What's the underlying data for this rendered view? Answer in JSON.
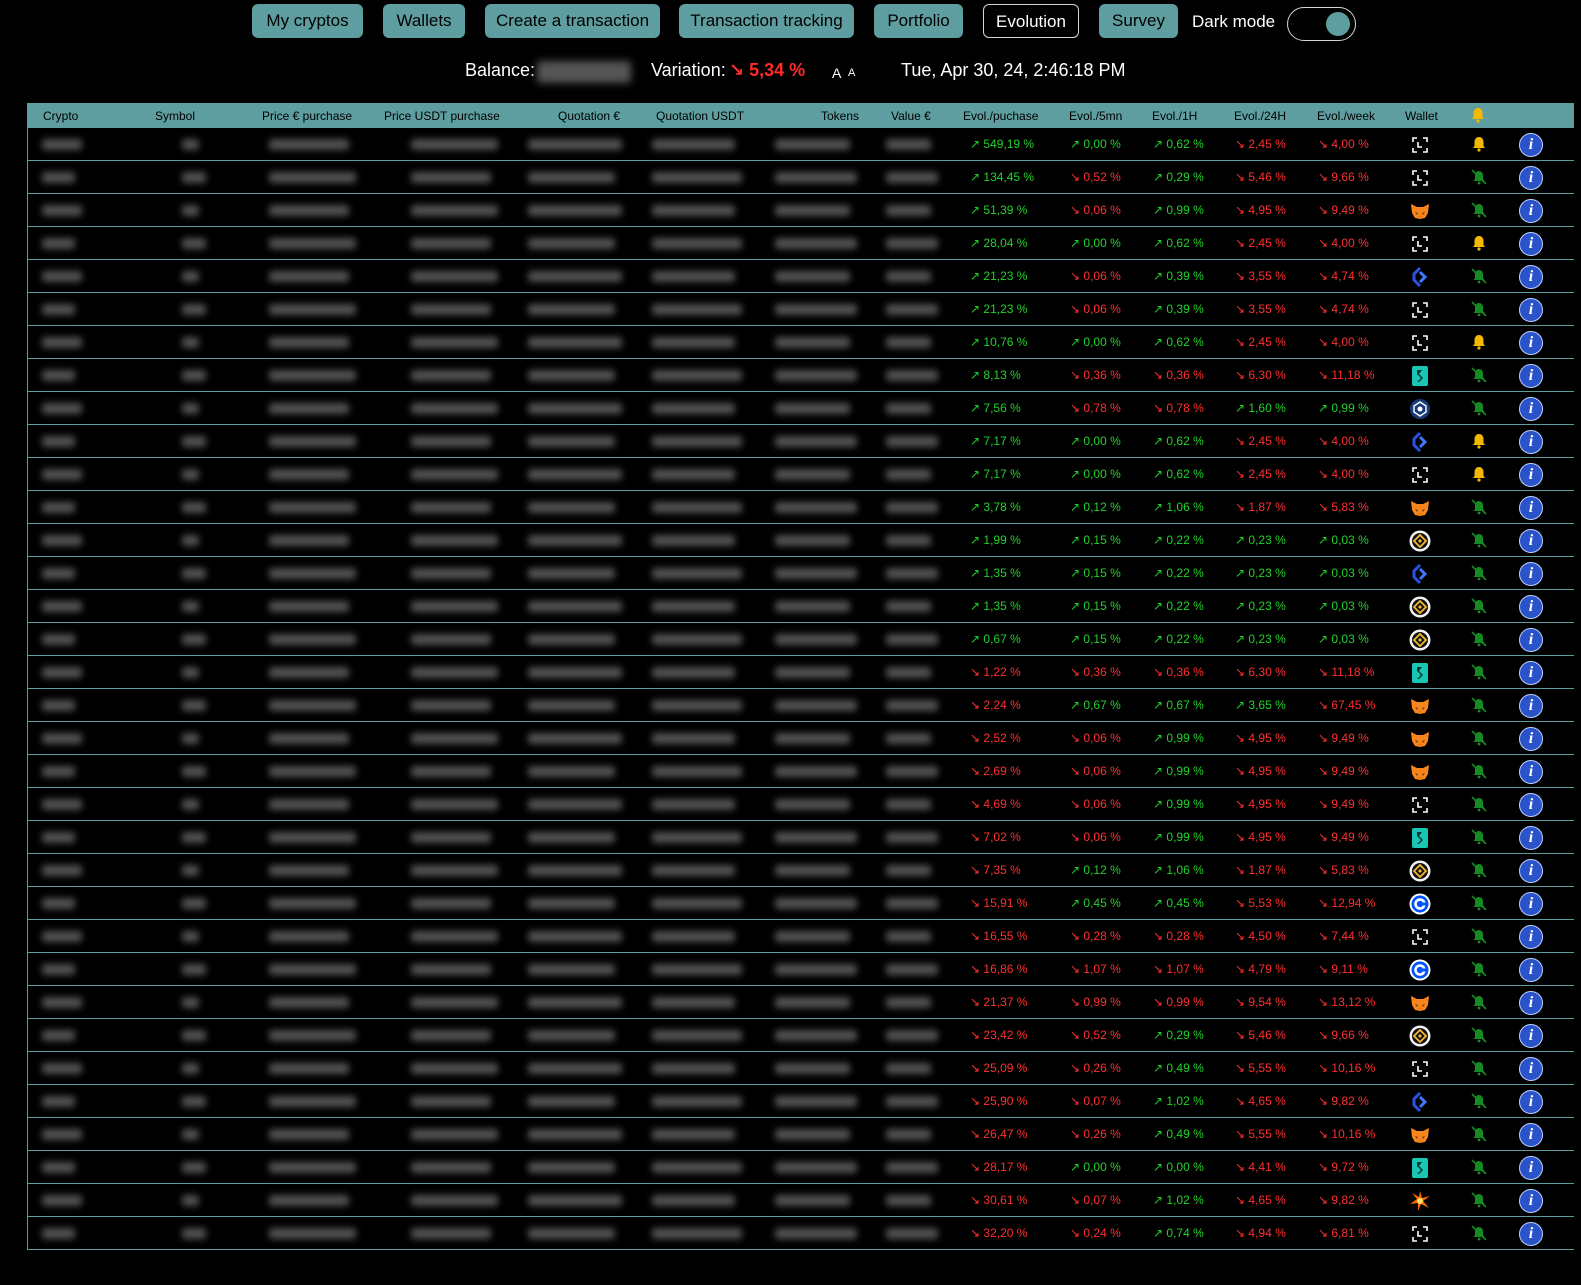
{
  "nav": {
    "buttons": [
      "My cryptos",
      "Wallets",
      "Create a transaction",
      "Transaction tracking",
      "Portfolio",
      "Evolution",
      "Survey"
    ],
    "active": "Evolution",
    "dark_mode_label": "Dark mode",
    "dark_mode_on": true
  },
  "status": {
    "balance_label": "Balance:",
    "variation_label": "Variation:",
    "variation_value": "↘ 5,34 %",
    "font_large": "A",
    "font_small": "A",
    "datetime": "Tue, Apr 30, 24, 2:46:18 PM"
  },
  "colors": {
    "accent": "#5f9ea0",
    "up": "#22d22a",
    "down": "#ff3030",
    "bell_on": "#f5b800",
    "info": "#2a52c9"
  },
  "table": {
    "headers": [
      "Crypto",
      "Symbol",
      "Price € purchase",
      "Price USDT purchase",
      "Quotation €",
      "Quotation USDT",
      "Tokens",
      "Value €",
      "Evol./puchase",
      "Evol./5mn",
      "Evol./1H",
      "Evol./24H",
      "Evol./week",
      "Wallet"
    ],
    "header_bell_icon": "bell-icon",
    "rows": [
      {
        "e": [
          "↗ 549,19 %",
          "↗ 0,00 %",
          "↗ 0,62 %",
          "↘ 2,45 %",
          "↘ 4,00 %"
        ],
        "wallet": "ledger-icon",
        "bell": "bell-on-icon"
      },
      {
        "e": [
          "↗ 134,45 %",
          "↘ 0,52 %",
          "↗ 0,29 %",
          "↘ 5,46 %",
          "↘ 9,66 %"
        ],
        "wallet": "ledger-icon",
        "bell": "bell-off-icon"
      },
      {
        "e": [
          "↗ 51,39 %",
          "↘ 0,06 %",
          "↗ 0,99 %",
          "↘ 4,95 %",
          "↘ 9,49 %"
        ],
        "wallet": "metamask-icon",
        "bell": "bell-off-icon"
      },
      {
        "e": [
          "↗ 28,04 %",
          "↗ 0,00 %",
          "↗ 0,62 %",
          "↘ 2,45 %",
          "↘ 4,00 %"
        ],
        "wallet": "ledger-icon",
        "bell": "bell-on-icon"
      },
      {
        "e": [
          "↗ 21,23 %",
          "↘ 0,06 %",
          "↗ 0,39 %",
          "↘ 3,55 %",
          "↘ 4,74 %"
        ],
        "wallet": "kucoin-icon",
        "bell": "bell-off-icon"
      },
      {
        "e": [
          "↗ 21,23 %",
          "↘ 0,06 %",
          "↗ 0,39 %",
          "↘ 3,55 %",
          "↘ 4,74 %"
        ],
        "wallet": "ledger-icon",
        "bell": "bell-off-icon"
      },
      {
        "e": [
          "↗ 10,76 %",
          "↗ 0,00 %",
          "↗ 0,62 %",
          "↘ 2,45 %",
          "↘ 4,00 %"
        ],
        "wallet": "ledger-icon",
        "bell": "bell-on-icon"
      },
      {
        "e": [
          "↗ 8,13 %",
          "↘ 0,36 %",
          "↘ 0,36 %",
          "↘ 6,30 %",
          "↘ 11,18 %"
        ],
        "wallet": "bitget-icon",
        "bell": "bell-off-icon"
      },
      {
        "e": [
          "↗ 7,56 %",
          "↘ 0,78 %",
          "↘ 0,78 %",
          "↗ 1,60 %",
          "↗ 0,99 %"
        ],
        "wallet": "cryptocom-icon",
        "bell": "bell-off-icon"
      },
      {
        "e": [
          "↗ 7,17 %",
          "↗ 0,00 %",
          "↗ 0,62 %",
          "↘ 2,45 %",
          "↘ 4,00 %"
        ],
        "wallet": "kucoin-icon",
        "bell": "bell-on-icon"
      },
      {
        "e": [
          "↗ 7,17 %",
          "↗ 0,00 %",
          "↗ 0,62 %",
          "↘ 2,45 %",
          "↘ 4,00 %"
        ],
        "wallet": "ledger-icon",
        "bell": "bell-on-icon"
      },
      {
        "e": [
          "↗ 3,78 %",
          "↗ 0,12 %",
          "↗ 1,06 %",
          "↘ 1,87 %",
          "↘ 5,83 %"
        ],
        "wallet": "metamask-icon",
        "bell": "bell-off-icon"
      },
      {
        "e": [
          "↗ 1,99 %",
          "↗ 0,15 %",
          "↗ 0,22 %",
          "↗ 0,23 %",
          "↗ 0,03 %"
        ],
        "wallet": "binance-icon",
        "bell": "bell-off-icon"
      },
      {
        "e": [
          "↗ 1,35 %",
          "↗ 0,15 %",
          "↗ 0,22 %",
          "↗ 0,23 %",
          "↗ 0,03 %"
        ],
        "wallet": "kucoin-icon",
        "bell": "bell-off-icon"
      },
      {
        "e": [
          "↗ 1,35 %",
          "↗ 0,15 %",
          "↗ 0,22 %",
          "↗ 0,23 %",
          "↗ 0,03 %"
        ],
        "wallet": "binance-icon",
        "bell": "bell-off-icon"
      },
      {
        "e": [
          "↗ 0,67 %",
          "↗ 0,15 %",
          "↗ 0,22 %",
          "↗ 0,23 %",
          "↗ 0,03 %"
        ],
        "wallet": "binance-icon",
        "bell": "bell-off-icon"
      },
      {
        "e": [
          "↘ 1,22 %",
          "↘ 0,36 %",
          "↘ 0,36 %",
          "↘ 6,30 %",
          "↘ 11,18 %"
        ],
        "wallet": "bitget-icon",
        "bell": "bell-off-icon"
      },
      {
        "e": [
          "↘ 2,24 %",
          "↗ 0,67 %",
          "↗ 0,67 %",
          "↗ 3,65 %",
          "↘ 67,45 %"
        ],
        "wallet": "metamask-icon",
        "bell": "bell-off-icon"
      },
      {
        "e": [
          "↘ 2,52 %",
          "↘ 0,06 %",
          "↗ 0,99 %",
          "↘ 4,95 %",
          "↘ 9,49 %"
        ],
        "wallet": "metamask-icon",
        "bell": "bell-off-icon"
      },
      {
        "e": [
          "↘ 2,69 %",
          "↘ 0,06 %",
          "↗ 0,99 %",
          "↘ 4,95 %",
          "↘ 9,49 %"
        ],
        "wallet": "metamask-icon",
        "bell": "bell-off-icon"
      },
      {
        "e": [
          "↘ 4,69 %",
          "↘ 0,06 %",
          "↗ 0,99 %",
          "↘ 4,95 %",
          "↘ 9,49 %"
        ],
        "wallet": "ledger-icon",
        "bell": "bell-off-icon"
      },
      {
        "e": [
          "↘ 7,02 %",
          "↘ 0,06 %",
          "↗ 0,99 %",
          "↘ 4,95 %",
          "↘ 9,49 %"
        ],
        "wallet": "bitget-icon",
        "bell": "bell-off-icon"
      },
      {
        "e": [
          "↘ 7,35 %",
          "↗ 0,12 %",
          "↗ 1,06 %",
          "↘ 1,87 %",
          "↘ 5,83 %"
        ],
        "wallet": "binance-icon",
        "bell": "bell-off-icon"
      },
      {
        "e": [
          "↘ 15,91 %",
          "↗ 0,45 %",
          "↗ 0,45 %",
          "↘ 5,53 %",
          "↘ 12,94 %"
        ],
        "wallet": "coinbase-icon",
        "bell": "bell-off-icon"
      },
      {
        "e": [
          "↘ 16,55 %",
          "↘ 0,28 %",
          "↘ 0,28 %",
          "↘ 4,50 %",
          "↘ 7,44 %"
        ],
        "wallet": "ledger-icon",
        "bell": "bell-off-icon"
      },
      {
        "e": [
          "↘ 16,86 %",
          "↘ 1,07 %",
          "↘ 1,07 %",
          "↘ 4,79 %",
          "↘ 9,11 %"
        ],
        "wallet": "coinbase-icon",
        "bell": "bell-off-icon"
      },
      {
        "e": [
          "↘ 21,37 %",
          "↘ 0,99 %",
          "↘ 0,99 %",
          "↘ 9,54 %",
          "↘ 13,12 %"
        ],
        "wallet": "metamask-icon",
        "bell": "bell-off-icon"
      },
      {
        "e": [
          "↘ 23,42 %",
          "↘ 0,52 %",
          "↗ 0,29 %",
          "↘ 5,46 %",
          "↘ 9,66 %"
        ],
        "wallet": "binance-icon",
        "bell": "bell-off-icon"
      },
      {
        "e": [
          "↘ 25,09 %",
          "↘ 0,26 %",
          "↗ 0,49 %",
          "↘ 5,55 %",
          "↘ 10,16 %"
        ],
        "wallet": "ledger-icon",
        "bell": "bell-off-icon"
      },
      {
        "e": [
          "↘ 25,90 %",
          "↘ 0,07 %",
          "↗ 1,02 %",
          "↘ 4,65 %",
          "↘ 9,82 %"
        ],
        "wallet": "kucoin-icon",
        "bell": "bell-off-icon"
      },
      {
        "e": [
          "↘ 26,47 %",
          "↘ 0,26 %",
          "↗ 0,49 %",
          "↘ 5,55 %",
          "↘ 10,16 %"
        ],
        "wallet": "metamask-icon",
        "bell": "bell-off-icon"
      },
      {
        "e": [
          "↘ 28,17 %",
          "↗ 0,00 %",
          "↗ 0,00 %",
          "↘ 4,41 %",
          "↘ 9,72 %"
        ],
        "wallet": "bitget-icon",
        "bell": "bell-off-icon"
      },
      {
        "e": [
          "↘ 30,61 %",
          "↘ 0,07 %",
          "↗ 1,02 %",
          "↘ 4,65 %",
          "↘ 9,82 %"
        ],
        "wallet": "spark-icon",
        "bell": "bell-off-icon"
      },
      {
        "e": [
          "↘ 32,20 %",
          "↘ 0,24 %",
          "↗ 0,74 %",
          "↘ 4,94 %",
          "↘ 6,81 %"
        ],
        "wallet": "ledger-icon",
        "bell": "bell-off-icon"
      }
    ],
    "info_label": "i"
  }
}
